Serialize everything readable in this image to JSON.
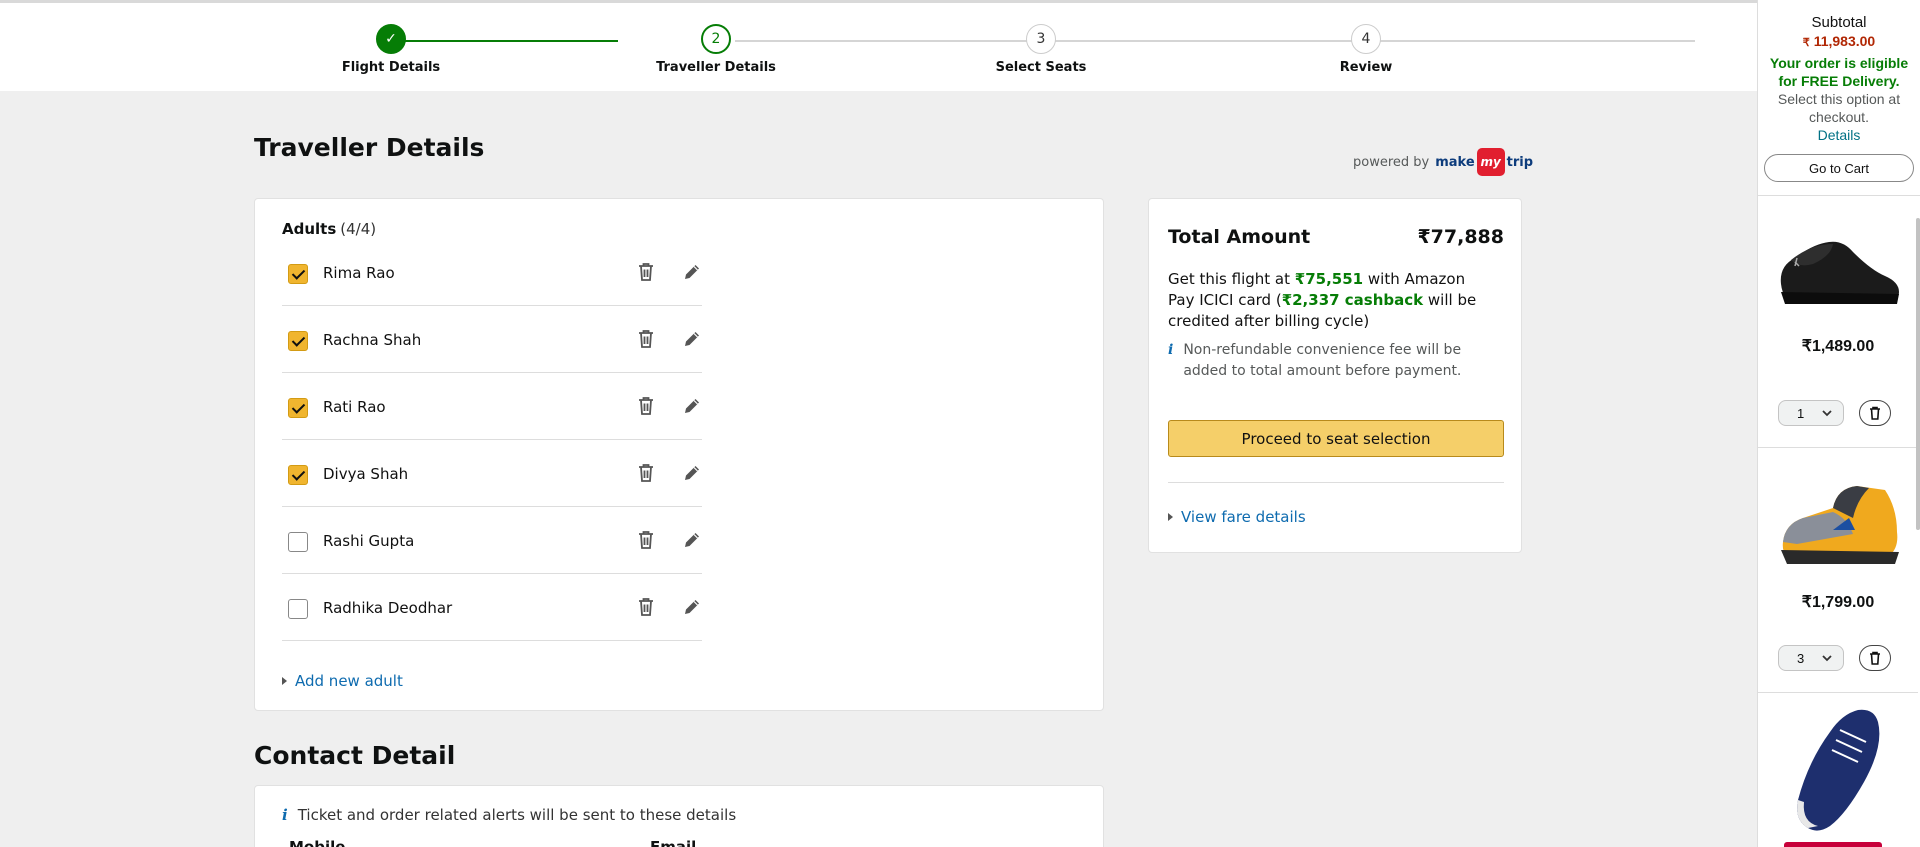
{
  "steps": [
    {
      "num": "✓",
      "label": "Flight Details",
      "state": "done"
    },
    {
      "num": "2",
      "label": "Traveller Details",
      "state": "active"
    },
    {
      "num": "3",
      "label": "Select Seats",
      "state": "pending"
    },
    {
      "num": "4",
      "label": "Review",
      "state": "pending"
    }
  ],
  "page": {
    "title": "Traveller Details",
    "powered_by": "powered by",
    "partner": {
      "pre": "make",
      "mid": "my",
      "post": "trip"
    }
  },
  "travellers": {
    "heading": "Adults",
    "count": "(4/4)",
    "list": [
      {
        "name": "Rima Rao",
        "checked": true
      },
      {
        "name": "Rachna Shah",
        "checked": true
      },
      {
        "name": "Rati Rao",
        "checked": true
      },
      {
        "name": "Divya Shah",
        "checked": true
      },
      {
        "name": "Rashi Gupta",
        "checked": false
      },
      {
        "name": "Radhika Deodhar",
        "checked": false
      }
    ],
    "add_new": "Add new adult"
  },
  "summary": {
    "total_label": "Total Amount",
    "total_value": "₹77,888",
    "offer_1": "Get this flight at ",
    "offer_price": "₹75,551",
    "offer_2": " with Amazon Pay ICICI card (",
    "offer_cashback": "₹2,337 cashback",
    "offer_3": " will be credited after billing cycle)",
    "note": "Non-refundable convenience fee will be added to total amount before payment.",
    "proceed": "Proceed to seat selection",
    "fare_link": "View fare details"
  },
  "contact": {
    "title": "Contact Detail",
    "note": "Ticket and order related alerts will be sent to these details",
    "mobile_label": "Mobile",
    "email_label": "Email"
  },
  "cart": {
    "subtotal_label": "Subtotal",
    "currency": "₹",
    "subtotal": "11,983.00",
    "free_bold": "Your order is eligible for FREE Delivery.",
    "free_rest": " Select this option at checkout.",
    "details": "Details",
    "go_to_cart": "Go to Cart",
    "items": [
      {
        "price": "₹1,489.00",
        "qty": "1"
      },
      {
        "price": "₹1,799.00",
        "qty": "3"
      }
    ]
  },
  "colors": {
    "accent_green": "#067d06",
    "link_blue": "#0e6baf",
    "button_yellow": "#f5cf69",
    "price_red": "#b12704"
  }
}
